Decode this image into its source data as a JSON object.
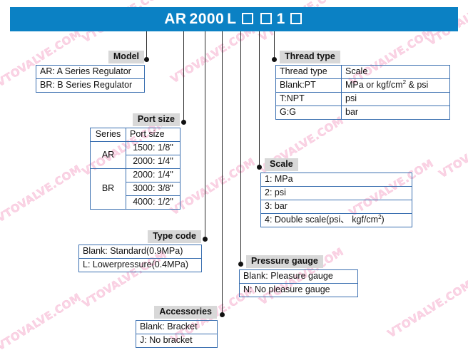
{
  "page": {
    "watermark_text": "VTOVALVE.COM",
    "banner_color": "#0b81c4",
    "label_bg_color": "#d8d8d8",
    "table_border_color": "#3a6fb0"
  },
  "header": {
    "code_parts": [
      "AR",
      "2000",
      "L",
      "□",
      "□",
      "1",
      "□"
    ],
    "code_text": "AR 2000 L □ □ 1 □",
    "prefix": "AR",
    "series_number": "2000",
    "type_code": "L",
    "scale_digit": "1"
  },
  "sections": {
    "model": {
      "label": "Model",
      "rows": [
        "AR: A Series Regulator",
        "BR: B Series Regulator"
      ]
    },
    "thread_type": {
      "label": "Thread type",
      "headers": [
        "Thread type",
        "Scale"
      ],
      "rows": [
        {
          "code": "Blank:PT",
          "scale": "MPa or  kgf/cm2 & psi",
          "scale_base": "MPa or  kgf/cm",
          "scale_sup": "2",
          "scale_tail": " & psi"
        },
        {
          "code": "T:NPT",
          "scale": "psi",
          "scale_base": "psi",
          "scale_sup": "",
          "scale_tail": ""
        },
        {
          "code": "G:G",
          "scale": "bar",
          "scale_base": "bar",
          "scale_sup": "",
          "scale_tail": ""
        }
      ]
    },
    "port_size": {
      "label": "Port size",
      "headers": [
        "Series",
        "Port size"
      ],
      "groups": [
        {
          "series": "AR",
          "sizes": [
            "1500: 1/8\"",
            "2000: 1/4\""
          ]
        },
        {
          "series": "BR",
          "sizes": [
            "2000: 1/4\"",
            "3000: 3/8\"",
            "4000: 1/2\""
          ]
        }
      ]
    },
    "scale": {
      "label": "Scale",
      "rows": [
        {
          "full": "1: MPa",
          "base": "1: MPa",
          "sup": "",
          "tail": ""
        },
        {
          "full": "2: psi",
          "base": "2: psi",
          "sup": "",
          "tail": ""
        },
        {
          "full": "3: bar",
          "base": "3: bar",
          "sup": "",
          "tail": ""
        },
        {
          "full": "4: Double scale(psi、 kgf/cm2)",
          "base": "4: Double scale(psi、 kgf/cm",
          "sup": "2",
          "tail": ")"
        }
      ]
    },
    "type_code": {
      "label": "Type code",
      "rows": [
        "Blank: Standard(0.9MPa)",
        "L: Lowerpressure(0.4MPa)"
      ]
    },
    "pressure_gauge": {
      "label": "Pressure gauge",
      "rows": [
        "Blank: Pleasure gauge",
        "N: No pleasure gauge"
      ]
    },
    "accessories": {
      "label": "Accessories",
      "rows": [
        "Blank: Bracket",
        "J: No bracket"
      ]
    }
  }
}
